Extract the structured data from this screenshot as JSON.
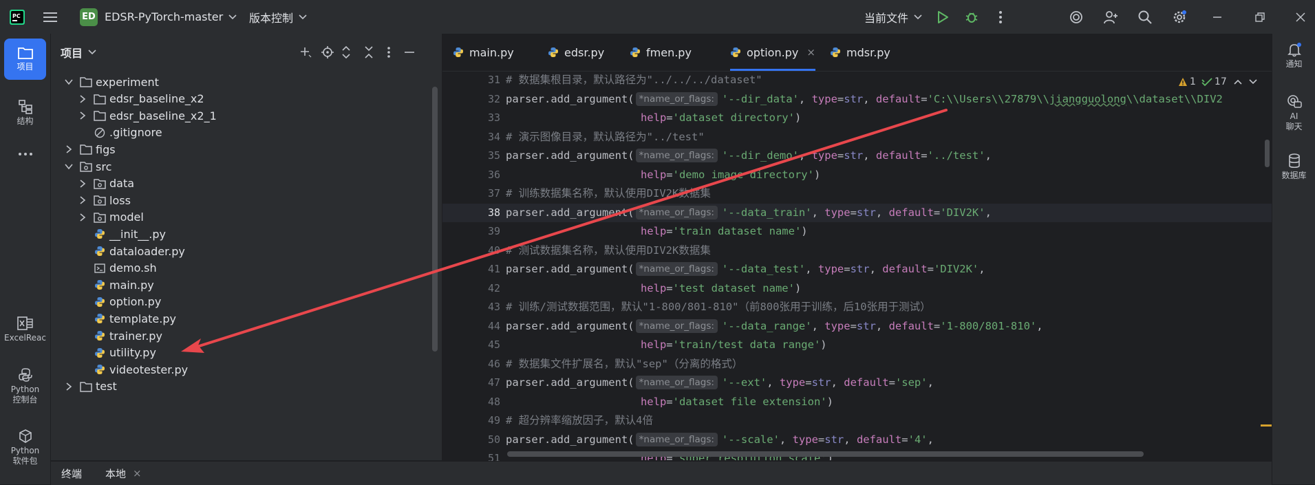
{
  "titlebar": {
    "project_badge": "ED",
    "project_name": "EDSR-PyTorch-master",
    "vcs_label": "版本控制",
    "run_config": "当前文件"
  },
  "left_strip": {
    "items": [
      {
        "label": "项目",
        "icon": "folder-icon",
        "active": true
      },
      {
        "label": "结构",
        "icon": "structure-icon"
      },
      {
        "label": "",
        "icon": "more-icon"
      },
      {
        "label": "ExcelReac",
        "icon": "excel-icon"
      },
      {
        "label": "Python\n控制台",
        "icon": "python-console-icon"
      },
      {
        "label": "Python\n软件包",
        "icon": "python-packages-icon"
      }
    ]
  },
  "project_panel": {
    "title": "项目",
    "tree": [
      {
        "name": "experiment",
        "type": "folder",
        "depth": 1,
        "expanded": true
      },
      {
        "name": "edsr_baseline_x2",
        "type": "folder",
        "depth": 2,
        "expanded": false
      },
      {
        "name": "edsr_baseline_x2_1",
        "type": "folder",
        "depth": 2,
        "expanded": false
      },
      {
        "name": ".gitignore",
        "type": "ignore",
        "depth": 2
      },
      {
        "name": "figs",
        "type": "folder",
        "depth": 1,
        "expanded": false
      },
      {
        "name": "src",
        "type": "package",
        "depth": 1,
        "expanded": true
      },
      {
        "name": "data",
        "type": "package",
        "depth": 2,
        "expanded": false
      },
      {
        "name": "loss",
        "type": "package",
        "depth": 2,
        "expanded": false
      },
      {
        "name": "model",
        "type": "package",
        "depth": 2,
        "expanded": false
      },
      {
        "name": "__init__.py",
        "type": "python",
        "depth": 2
      },
      {
        "name": "dataloader.py",
        "type": "python",
        "depth": 2
      },
      {
        "name": "demo.sh",
        "type": "shell",
        "depth": 2
      },
      {
        "name": "main.py",
        "type": "python",
        "depth": 2
      },
      {
        "name": "option.py",
        "type": "python",
        "depth": 2
      },
      {
        "name": "template.py",
        "type": "python",
        "depth": 2
      },
      {
        "name": "trainer.py",
        "type": "python",
        "depth": 2
      },
      {
        "name": "utility.py",
        "type": "python",
        "depth": 2
      },
      {
        "name": "videotester.py",
        "type": "python",
        "depth": 2
      },
      {
        "name": "test",
        "type": "folder",
        "depth": 1,
        "expanded": false
      }
    ]
  },
  "editor": {
    "tabs": [
      {
        "label": "main.py"
      },
      {
        "label": "edsr.py"
      },
      {
        "label": "fmen.py"
      },
      {
        "label": "option.py",
        "active": true
      },
      {
        "label": "mdsr.py"
      }
    ],
    "close_glyph": "×",
    "inspections": {
      "warnings": "1",
      "weak_warnings": "17"
    },
    "current_line": 38,
    "lines": [
      {
        "n": 31,
        "parts": [
          [
            "cm",
            "# 数据集根目录，默认路径为\"../../../dataset\""
          ]
        ]
      },
      {
        "n": 32,
        "parts": [
          [
            "",
            "parser.add_argument("
          ],
          [
            "hint",
            "*name_or_flags:"
          ],
          [
            "str",
            "'--dir_data'"
          ],
          [
            "",
            ", "
          ],
          [
            "kw",
            "type"
          ],
          [
            "",
            "="
          ],
          [
            "bi",
            "str"
          ],
          [
            "",
            ", "
          ],
          [
            "kw",
            "default"
          ],
          [
            "",
            "="
          ],
          [
            "str",
            "'C:\\\\Users\\\\27879\\\\"
          ],
          [
            "strul",
            "jiangguolong"
          ],
          [
            "str",
            "\\\\dataset\\\\DIV2"
          ]
        ]
      },
      {
        "n": 33,
        "parts": [
          [
            "",
            "                     "
          ],
          [
            "kw",
            "help"
          ],
          [
            "",
            "="
          ],
          [
            "str",
            "'dataset directory'"
          ],
          [
            "",
            ")"
          ]
        ]
      },
      {
        "n": 34,
        "parts": [
          [
            "cm",
            "# 演示图像目录，默认路径为\"../test\""
          ]
        ]
      },
      {
        "n": 35,
        "parts": [
          [
            "",
            "parser.add_argument("
          ],
          [
            "hint",
            "*name_or_flags:"
          ],
          [
            "str",
            "'--dir_demo'"
          ],
          [
            "",
            ", "
          ],
          [
            "kw",
            "type"
          ],
          [
            "",
            "="
          ],
          [
            "bi",
            "str"
          ],
          [
            "",
            ", "
          ],
          [
            "kw",
            "default"
          ],
          [
            "",
            "="
          ],
          [
            "str",
            "'../test'"
          ],
          [
            "",
            ","
          ]
        ]
      },
      {
        "n": 36,
        "parts": [
          [
            "",
            "                     "
          ],
          [
            "kw",
            "help"
          ],
          [
            "",
            "="
          ],
          [
            "str",
            "'demo image directory'"
          ],
          [
            "",
            ")"
          ]
        ]
      },
      {
        "n": 37,
        "parts": [
          [
            "cm",
            "# 训练数据集名称，默认使用DIV2K数据集"
          ]
        ]
      },
      {
        "n": 38,
        "parts": [
          [
            "",
            "parser.add_argument("
          ],
          [
            "hint",
            "*name_or_flags:"
          ],
          [
            "str",
            "'--data_train'"
          ],
          [
            "",
            ", "
          ],
          [
            "kw",
            "type"
          ],
          [
            "",
            "="
          ],
          [
            "bi",
            "str"
          ],
          [
            "",
            ", "
          ],
          [
            "kw",
            "default"
          ],
          [
            "",
            "="
          ],
          [
            "str",
            "'DIV2K'"
          ],
          [
            "",
            ","
          ]
        ]
      },
      {
        "n": 39,
        "parts": [
          [
            "",
            "                     "
          ],
          [
            "kw",
            "help"
          ],
          [
            "",
            "="
          ],
          [
            "str",
            "'train dataset name'"
          ],
          [
            "",
            ")"
          ]
        ]
      },
      {
        "n": 40,
        "parts": [
          [
            "cm",
            "# 测试数据集名称，默认使用DIV2K数据集"
          ]
        ]
      },
      {
        "n": 41,
        "parts": [
          [
            "",
            "parser.add_argument("
          ],
          [
            "hint",
            "*name_or_flags:"
          ],
          [
            "str",
            "'--data_test'"
          ],
          [
            "",
            ", "
          ],
          [
            "kw",
            "type"
          ],
          [
            "",
            "="
          ],
          [
            "bi",
            "str"
          ],
          [
            "",
            ", "
          ],
          [
            "kw",
            "default"
          ],
          [
            "",
            "="
          ],
          [
            "str",
            "'DIV2K'"
          ],
          [
            "",
            ","
          ]
        ]
      },
      {
        "n": 42,
        "parts": [
          [
            "",
            "                     "
          ],
          [
            "kw",
            "help"
          ],
          [
            "",
            "="
          ],
          [
            "str",
            "'test dataset name'"
          ],
          [
            "",
            ")"
          ]
        ]
      },
      {
        "n": 43,
        "parts": [
          [
            "cm",
            "# 训练/测试数据范围，默认\"1-800/801-810\"（前800张用于训练，后10张用于测试）"
          ]
        ]
      },
      {
        "n": 44,
        "parts": [
          [
            "",
            "parser.add_argument("
          ],
          [
            "hint",
            "*name_or_flags:"
          ],
          [
            "str",
            "'--data_range'"
          ],
          [
            "",
            ", "
          ],
          [
            "kw",
            "type"
          ],
          [
            "",
            "="
          ],
          [
            "bi",
            "str"
          ],
          [
            "",
            ", "
          ],
          [
            "kw",
            "default"
          ],
          [
            "",
            "="
          ],
          [
            "str",
            "'1-800/801-810'"
          ],
          [
            "",
            ","
          ]
        ]
      },
      {
        "n": 45,
        "parts": [
          [
            "",
            "                     "
          ],
          [
            "kw",
            "help"
          ],
          [
            "",
            "="
          ],
          [
            "str",
            "'train/test data range'"
          ],
          [
            "",
            ")"
          ]
        ]
      },
      {
        "n": 46,
        "parts": [
          [
            "cm",
            "# 数据集文件扩展名，默认\"sep\"（分离的格式）"
          ]
        ]
      },
      {
        "n": 47,
        "parts": [
          [
            "",
            "parser.add_argument("
          ],
          [
            "hint",
            "*name_or_flags:"
          ],
          [
            "str",
            "'--ext'"
          ],
          [
            "",
            ", "
          ],
          [
            "kw",
            "type"
          ],
          [
            "",
            "="
          ],
          [
            "bi",
            "str"
          ],
          [
            "",
            ", "
          ],
          [
            "kw",
            "default"
          ],
          [
            "",
            "="
          ],
          [
            "str",
            "'sep'"
          ],
          [
            "",
            ","
          ]
        ]
      },
      {
        "n": 48,
        "parts": [
          [
            "",
            "                     "
          ],
          [
            "kw",
            "help"
          ],
          [
            "",
            "="
          ],
          [
            "str",
            "'dataset file extension'"
          ],
          [
            "",
            ")"
          ]
        ]
      },
      {
        "n": 49,
        "parts": [
          [
            "cm",
            "# 超分辨率缩放因子，默认4倍"
          ]
        ]
      },
      {
        "n": 50,
        "parts": [
          [
            "",
            "parser.add_argument("
          ],
          [
            "hint",
            "*name_or_flags:"
          ],
          [
            "str",
            "'--scale'"
          ],
          [
            "",
            ", "
          ],
          [
            "kw",
            "type"
          ],
          [
            "",
            "="
          ],
          [
            "bi",
            "str"
          ],
          [
            "",
            ", "
          ],
          [
            "kw",
            "default"
          ],
          [
            "",
            "="
          ],
          [
            "str",
            "'4'"
          ],
          [
            "",
            ","
          ]
        ]
      },
      {
        "n": 51,
        "parts": [
          [
            "",
            "                     "
          ],
          [
            "kw",
            "help"
          ],
          [
            "",
            "="
          ],
          [
            "str",
            "'super resolution scale'"
          ],
          [
            "",
            ")"
          ]
        ]
      }
    ]
  },
  "right_strip": {
    "items": [
      {
        "label": "通知",
        "icon": "bell-icon"
      },
      {
        "label": "AI\n聊天",
        "icon": "ai-chat-icon"
      },
      {
        "label": "数据库",
        "icon": "database-icon"
      }
    ]
  },
  "bottom": {
    "tabs": [
      {
        "label": "终端"
      },
      {
        "label": "本地"
      }
    ],
    "close_glyph": "×"
  },
  "colors": {
    "accent": "#3574f0",
    "arrow": "#e8474c",
    "string": "#6aab73",
    "keyword": "#c77dbb",
    "comment": "#7a7e85",
    "python_blue": "#4d8ad4",
    "python_yellow": "#f2c94c"
  }
}
